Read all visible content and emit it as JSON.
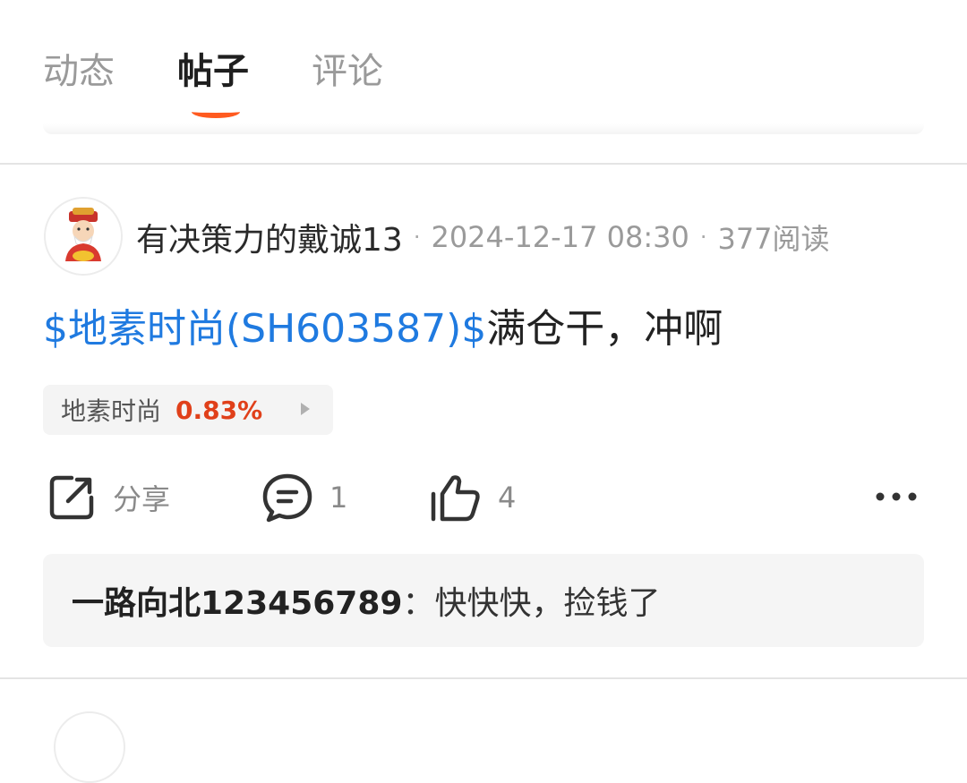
{
  "tabs": [
    {
      "label": "动态",
      "active": false
    },
    {
      "label": "帖子",
      "active": true
    },
    {
      "label": "评论",
      "active": false
    }
  ],
  "post": {
    "author": "有决策力的戴诚13",
    "sep1": "·",
    "time": "2024-12-17 08:30",
    "sep2": "·",
    "reads": "377阅读",
    "stock_link": "$地素时尚(SH603587)$",
    "text": "满仓干，冲啊",
    "stock_chip": {
      "name": "地素时尚",
      "change": "0.83%"
    },
    "actions": {
      "share_label": "分享",
      "comment_count": "1",
      "like_count": "4"
    },
    "comment_preview": {
      "author": "一路向北123456789",
      "colon": "：",
      "text": "快快快，捡钱了"
    }
  },
  "icons": {
    "share": "share-icon",
    "comment": "comment-icon",
    "like": "thumbs-up-icon",
    "more": "more-dots-icon",
    "avatar": "god-of-wealth-avatar"
  },
  "colors": {
    "accent": "#ff5a1f",
    "link": "#1f7ae0",
    "up": "#e0401a"
  }
}
